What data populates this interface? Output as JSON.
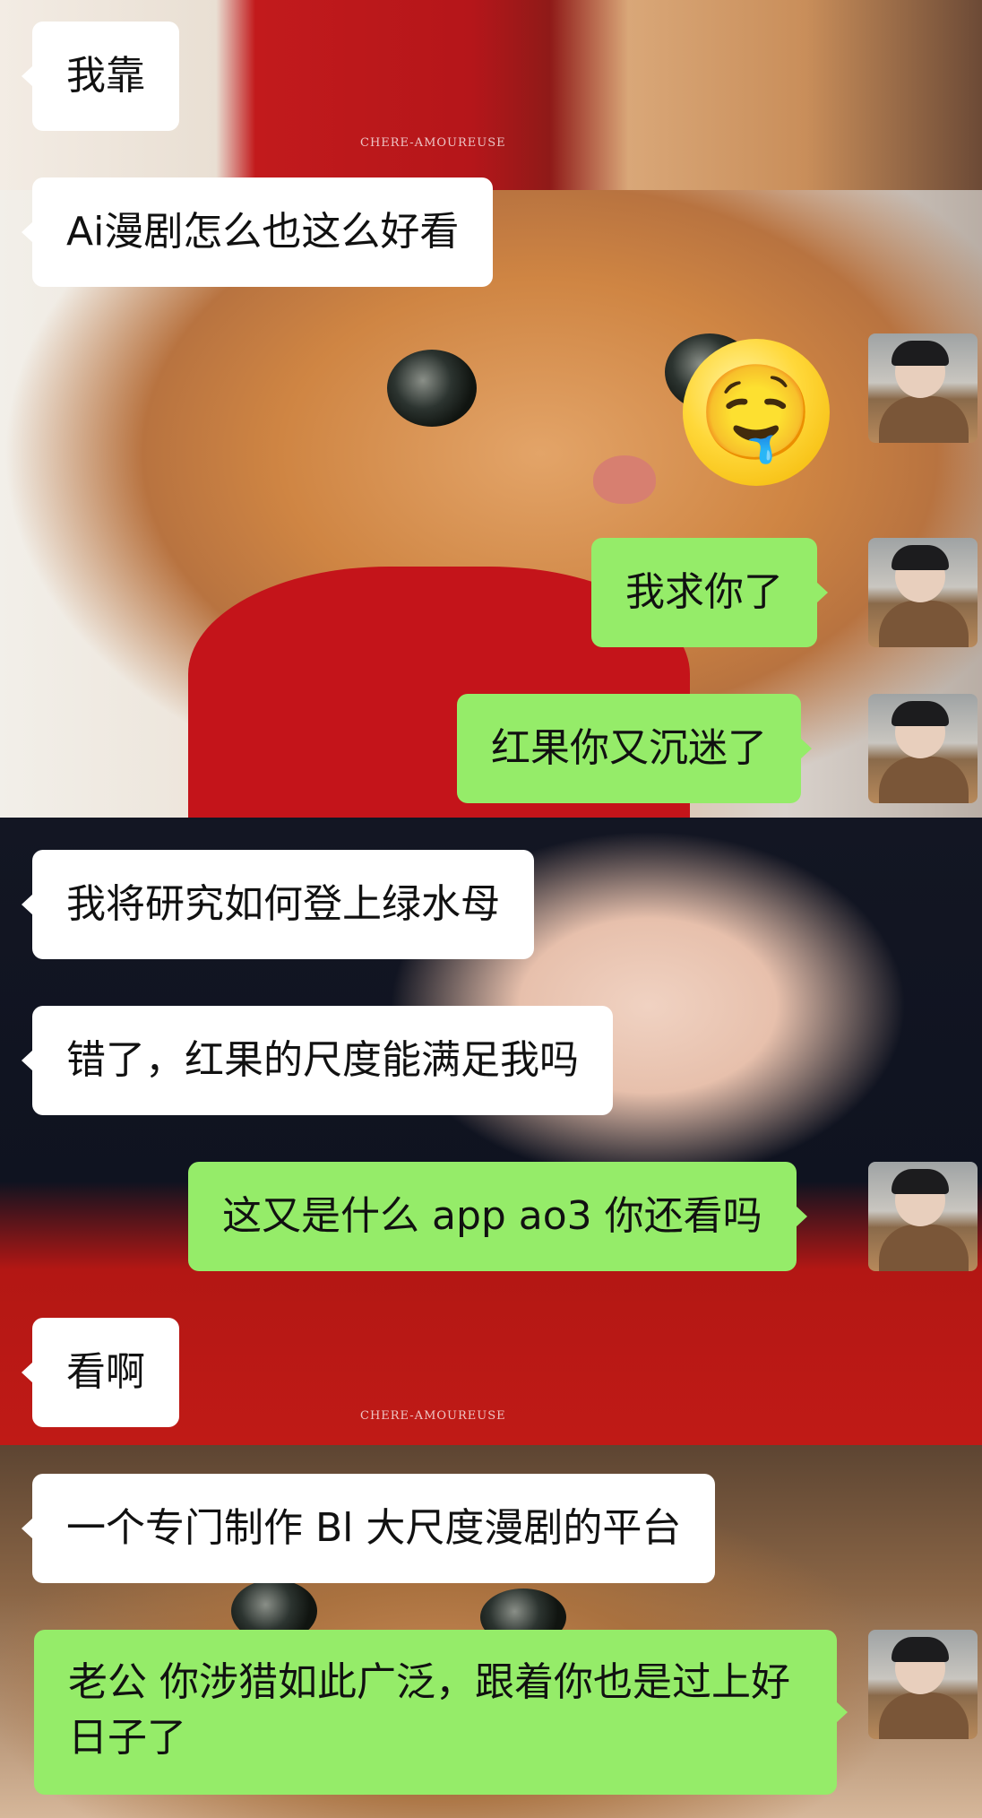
{
  "background": {
    "watermark_top": "CHERE-AMOUREUSE",
    "watermark_bottom": "CHERE-AMOUREUSE"
  },
  "sticker": {
    "emoji": "🤤",
    "icon": "drooling-face-sticker"
  },
  "messages": [
    {
      "side": "left",
      "text": "我靠"
    },
    {
      "side": "left",
      "text": "Ai漫剧怎么也这么好看"
    },
    {
      "side": "right",
      "text": "我求你了"
    },
    {
      "side": "right",
      "text": "红果你又沉迷了"
    },
    {
      "side": "left",
      "text": "我将研究如何登上绿水母"
    },
    {
      "side": "left",
      "text": "错了，红果的尺度能满足我吗"
    },
    {
      "side": "right",
      "text": "这又是什么 app ao3 你还看吗"
    },
    {
      "side": "left",
      "text": "看啊"
    },
    {
      "side": "left",
      "text": "一个专门制作 Bl 大尺度漫剧的平台"
    },
    {
      "side": "right",
      "text": "老公 你涉猎如此广泛，跟着你也是过上好日子了"
    }
  ],
  "colors": {
    "incoming_bubble": "#ffffff",
    "outgoing_bubble": "#95ec69",
    "text": "#111111"
  }
}
